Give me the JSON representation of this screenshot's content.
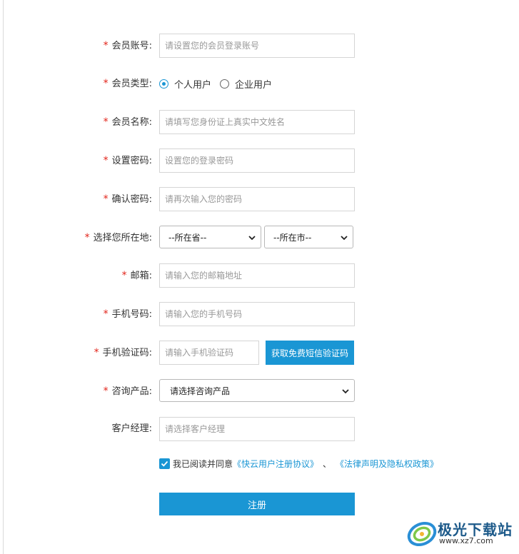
{
  "form": {
    "account": {
      "label": "会员账号:",
      "placeholder": "请设置您的会员登录账号",
      "required": true
    },
    "member_type": {
      "label": "会员类型:",
      "options": [
        "个人用户",
        "企业用户"
      ],
      "selected": "个人用户",
      "required": true
    },
    "member_name": {
      "label": "会员名称:",
      "placeholder": "请填写您身份证上真实中文姓名",
      "required": true
    },
    "password": {
      "label": "设置密码:",
      "placeholder": "设置您的登录密码",
      "required": true
    },
    "confirm_password": {
      "label": "确认密码:",
      "placeholder": "请再次输入您的密码",
      "required": true
    },
    "location": {
      "label": "选择您所在地:",
      "province": "--所在省--",
      "city": "--所在市--",
      "required": true
    },
    "email": {
      "label": "邮箱:",
      "placeholder": "请输入您的邮箱地址",
      "required": true
    },
    "phone": {
      "label": "手机号码:",
      "placeholder": "请输入您的手机号码",
      "required": true
    },
    "sms_code": {
      "label": "手机验证码:",
      "placeholder": "请输入手机验证码",
      "button": "获取免费短信验证码",
      "required": true
    },
    "product": {
      "label": "咨询产品:",
      "selected": "请选择咨询产品",
      "required": true
    },
    "manager": {
      "label": "客户经理:",
      "placeholder": "请选择客户经理",
      "required": false
    }
  },
  "agreement": {
    "checked": true,
    "text": "我已阅读并同意",
    "link1": "《快云用户注册协议》",
    "separator": "、",
    "link2": "《法律声明及隐私权政策》"
  },
  "submit_label": "注册",
  "required_mark": "*",
  "watermark": {
    "title": "极光下载站",
    "url": "www.xz7.com"
  },
  "colors": {
    "accent": "#1a96d4",
    "required": "#e2231a"
  }
}
